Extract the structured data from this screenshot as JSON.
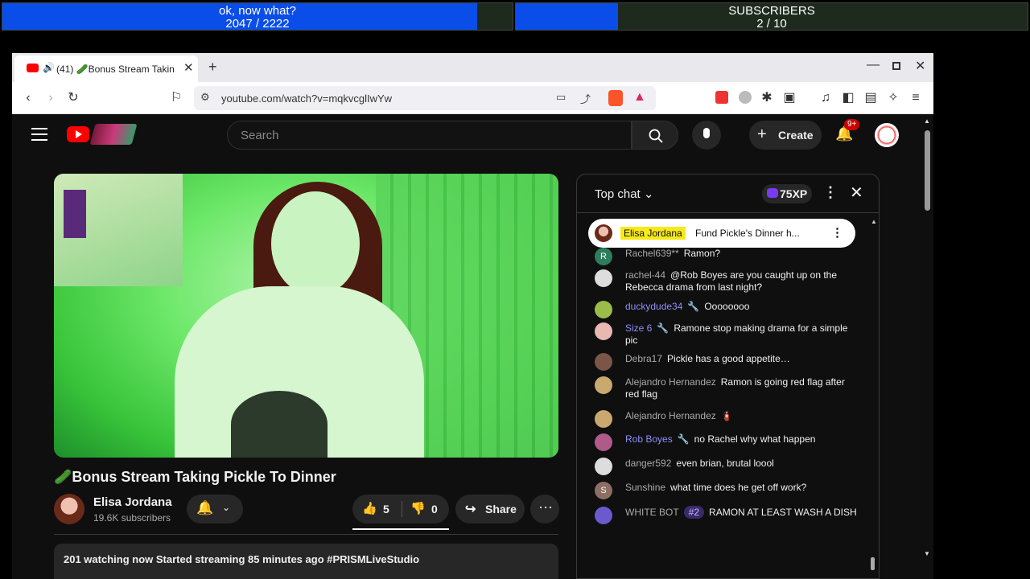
{
  "overlay": {
    "bar1": {
      "line1": "ok, now what?",
      "current": "2047",
      "sep": " / ",
      "total": "2222",
      "progress": 0.93
    },
    "bar2": {
      "line1": "SUBSCRIBERS",
      "current": "2",
      "sep": " / ",
      "total": "10",
      "progress": 0.2
    }
  },
  "browser": {
    "tab": {
      "count": "(41)",
      "title": "🥒Bonus Stream Takin"
    },
    "url": "youtube.com/watch?v=mqkvcglIwYw"
  },
  "youtube": {
    "search_placeholder": "Search",
    "create_label": "Create",
    "notif_badge": "9+",
    "video": {
      "title": "🥒Bonus Stream Taking Pickle To Dinner",
      "channel": "Elisa Jordana",
      "subscribers": "19.6K subscribers",
      "likes": "5",
      "dislikes": "0",
      "share_label": "Share",
      "description": "201 watching now  Started streaming 85 minutes ago  #PRISMLiveStudio"
    },
    "chat": {
      "mode": "Top chat",
      "xp": "75XP",
      "pinned": {
        "author": "Elisa Jordana",
        "text": "Fund Pickle's Dinner h..."
      },
      "messages": [
        {
          "author": "Rachel639**",
          "text": "Ramon?",
          "mod": false,
          "avatar_letter": "R",
          "color": "#2e7d5b"
        },
        {
          "author": "rachel-44",
          "text": "@Rob Boyes are you caught up on the Rebecca drama from last night?",
          "mod": false,
          "avatar_letter": "",
          "color": "#ddd"
        },
        {
          "author": "duckydude34",
          "text": "Oooooooo",
          "mod": true,
          "avatar_letter": "",
          "color": "#9bbb4a"
        },
        {
          "author": "Size 6",
          "text": "Ramone stop making drama for a simple pic",
          "mod": true,
          "avatar_letter": "",
          "color": "#e9b8b0"
        },
        {
          "author": "Debra17",
          "text": "Pickle has a good appetite…",
          "mod": false,
          "avatar_letter": "",
          "color": "#7a5548"
        },
        {
          "author": "Alejandro Hernandez",
          "text": "Ramon is going red flag after red flag",
          "mod": false,
          "avatar_letter": "",
          "color": "#c9a96e"
        },
        {
          "author": "Alejandro Hernandez",
          "text": "🧯",
          "mod": false,
          "avatar_letter": "",
          "color": "#c9a96e"
        },
        {
          "author": "Rob Boyes",
          "text": "no Rachel why what happen",
          "mod": true,
          "avatar_letter": "",
          "color": "#b05a8a"
        },
        {
          "author": "danger592",
          "text": "even brian, brutal loool",
          "mod": false,
          "avatar_letter": "",
          "color": "#ddd"
        },
        {
          "author": "Sunshine",
          "text": "what time does he get off work?",
          "mod": false,
          "avatar_letter": "S",
          "color": "#8d6e63"
        },
        {
          "author": "WHITE BOT",
          "badge": "#2",
          "text": "RAMON AT LEAST WASH A DISH",
          "mod": false,
          "avatar_letter": "",
          "color": "#6a5acd"
        }
      ]
    }
  },
  "colors": {
    "accent_blue": "#0a4de8",
    "yt_red": "#ff0000",
    "highlight_yellow": "#f7e91a"
  }
}
